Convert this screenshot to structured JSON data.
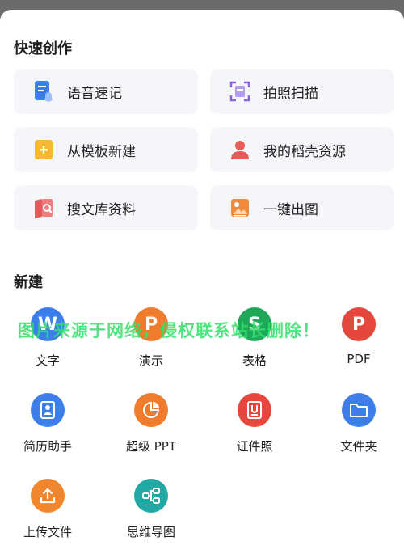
{
  "quick_create": {
    "title": "快速创作",
    "cards": [
      {
        "label": "语音速记",
        "icon": "voice-note-icon",
        "color": "#3d7bf0"
      },
      {
        "label": "拍照扫描",
        "icon": "scan-icon",
        "color": "#8a63e6"
      },
      {
        "label": "从模板新建",
        "icon": "template-icon",
        "color": "#f7b733"
      },
      {
        "label": "我的稻壳资源",
        "icon": "user-icon",
        "color": "#e85b5b"
      },
      {
        "label": "搜文库资料",
        "icon": "library-search-icon",
        "color": "#e25c5c"
      },
      {
        "label": "一键出图",
        "icon": "image-generate-icon",
        "color": "#f08a3c"
      }
    ]
  },
  "new_section": {
    "title": "新建",
    "items": [
      {
        "label": "文字",
        "glyph": "W",
        "icon": "writer-icon",
        "color": "#3b7de9"
      },
      {
        "label": "演示",
        "glyph": "P",
        "icon": "presentation-icon",
        "color": "#ef7b2c"
      },
      {
        "label": "表格",
        "glyph": "S",
        "icon": "spreadsheet-icon",
        "color": "#1fa85a"
      },
      {
        "label": "PDF",
        "glyph": "P",
        "icon": "pdf-icon",
        "color": "#e5473c"
      },
      {
        "label": "简历助手",
        "glyph": "",
        "icon": "resume-icon",
        "color": "#3d7ee8"
      },
      {
        "label": "超级 PPT",
        "glyph": "",
        "icon": "pie-chart-icon",
        "color": "#ef7b2c"
      },
      {
        "label": "证件照",
        "glyph": "",
        "icon": "id-photo-icon",
        "color": "#e5473c"
      },
      {
        "label": "文件夹",
        "glyph": "",
        "icon": "folder-icon",
        "color": "#3d7ee8"
      },
      {
        "label": "上传文件",
        "glyph": "",
        "icon": "upload-icon",
        "color": "#f0862e"
      },
      {
        "label": "思维导图",
        "glyph": "",
        "icon": "mind-map-icon",
        "color": "#22a9a5"
      }
    ]
  },
  "watermark": "图片来源于网络，侵权联系站长删除！"
}
